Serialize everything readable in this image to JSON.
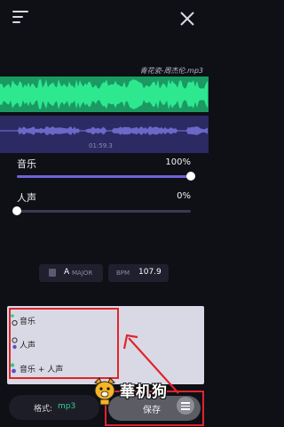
{
  "header": {
    "menu_icon": "menu-icon",
    "close_icon": "close-icon"
  },
  "track": {
    "title": "青花瓷-周杰伦.mp3",
    "time": "01:59.3"
  },
  "mixer": {
    "music": {
      "label": "音乐",
      "percent_text": "100%",
      "value": 1.0
    },
    "vocal": {
      "label": "人声",
      "percent_text": "0%",
      "value": 0.0
    }
  },
  "info": {
    "key_value": "A",
    "key_scale": "MAJOR",
    "bpm_label": "BPM",
    "bpm_value": "107.9"
  },
  "dropdown": {
    "options": [
      {
        "label": "音乐"
      },
      {
        "label": "人声"
      },
      {
        "label": "音乐 + 人声"
      }
    ]
  },
  "footer": {
    "format_label": "格式:",
    "format_value": "mp3",
    "save_label": "保存"
  },
  "watermark": {
    "text": "華机狗"
  },
  "colors": {
    "background": "#0f0f16",
    "waveform_green": "#2ee88f",
    "waveform_blue_bg": "#2b2a62",
    "slider_fill": "#6d63d8",
    "annotation_red": "#e0252a",
    "format_green": "#35d08f"
  }
}
